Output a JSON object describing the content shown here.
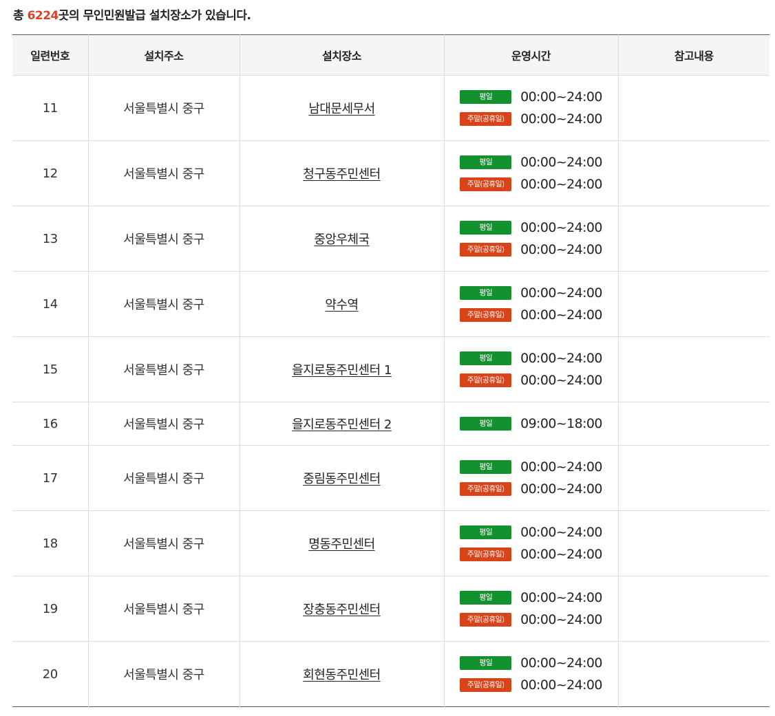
{
  "summary": {
    "prefix": "총 ",
    "count": "6224",
    "suffix": "곳의 무인민원발급 설치장소가 있습니다."
  },
  "table": {
    "headers": [
      "일련번호",
      "설치주소",
      "설치장소",
      "운영시간",
      "참고내용"
    ],
    "rows": [
      {
        "no": "11",
        "address": "서울특별시 중구",
        "place": "남대문세무서",
        "hours": [
          {
            "label": "평일",
            "type": "weekday",
            "time": "00:00~24:00"
          },
          {
            "label": "주말(공휴일)",
            "type": "weekend",
            "time": "00:00~24:00"
          }
        ],
        "note": ""
      },
      {
        "no": "12",
        "address": "서울특별시 중구",
        "place": "청구동주민센터",
        "hours": [
          {
            "label": "평일",
            "type": "weekday",
            "time": "00:00~24:00"
          },
          {
            "label": "주말(공휴일)",
            "type": "weekend",
            "time": "00:00~24:00"
          }
        ],
        "note": ""
      },
      {
        "no": "13",
        "address": "서울특별시 중구",
        "place": "중앙우체국",
        "hours": [
          {
            "label": "평일",
            "type": "weekday",
            "time": "00:00~24:00"
          },
          {
            "label": "주말(공휴일)",
            "type": "weekend",
            "time": "00:00~24:00"
          }
        ],
        "note": ""
      },
      {
        "no": "14",
        "address": "서울특별시 중구",
        "place": "약수역",
        "hours": [
          {
            "label": "평일",
            "type": "weekday",
            "time": "00:00~24:00"
          },
          {
            "label": "주말(공휴일)",
            "type": "weekend",
            "time": "00:00~24:00"
          }
        ],
        "note": ""
      },
      {
        "no": "15",
        "address": "서울특별시 중구",
        "place": "을지로동주민센터 1",
        "hours": [
          {
            "label": "평일",
            "type": "weekday",
            "time": "00:00~24:00"
          },
          {
            "label": "주말(공휴일)",
            "type": "weekend",
            "time": "00:00~24:00"
          }
        ],
        "note": ""
      },
      {
        "no": "16",
        "address": "서울특별시 중구",
        "place": "을지로동주민센터 2",
        "hours": [
          {
            "label": "평일",
            "type": "weekday",
            "time": "09:00~18:00"
          }
        ],
        "note": ""
      },
      {
        "no": "17",
        "address": "서울특별시 중구",
        "place": "중림동주민센터",
        "hours": [
          {
            "label": "평일",
            "type": "weekday",
            "time": "00:00~24:00"
          },
          {
            "label": "주말(공휴일)",
            "type": "weekend",
            "time": "00:00~24:00"
          }
        ],
        "note": ""
      },
      {
        "no": "18",
        "address": "서울특별시 중구",
        "place": "명동주민센터",
        "hours": [
          {
            "label": "평일",
            "type": "weekday",
            "time": "00:00~24:00"
          },
          {
            "label": "주말(공휴일)",
            "type": "weekend",
            "time": "00:00~24:00"
          }
        ],
        "note": ""
      },
      {
        "no": "19",
        "address": "서울특별시 중구",
        "place": "장충동주민센터",
        "hours": [
          {
            "label": "평일",
            "type": "weekday",
            "time": "00:00~24:00"
          },
          {
            "label": "주말(공휴일)",
            "type": "weekend",
            "time": "00:00~24:00"
          }
        ],
        "note": ""
      },
      {
        "no": "20",
        "address": "서울특별시 중구",
        "place": "회현동주민센터",
        "hours": [
          {
            "label": "평일",
            "type": "weekday",
            "time": "00:00~24:00"
          },
          {
            "label": "주말(공휴일)",
            "type": "weekend",
            "time": "00:00~24:00"
          }
        ],
        "note": ""
      }
    ]
  },
  "colors": {
    "count_highlight": "#d8432b",
    "weekday_badge": "#14912f",
    "weekend_badge": "#d8431a",
    "header_bg": "#f5f5f5"
  }
}
